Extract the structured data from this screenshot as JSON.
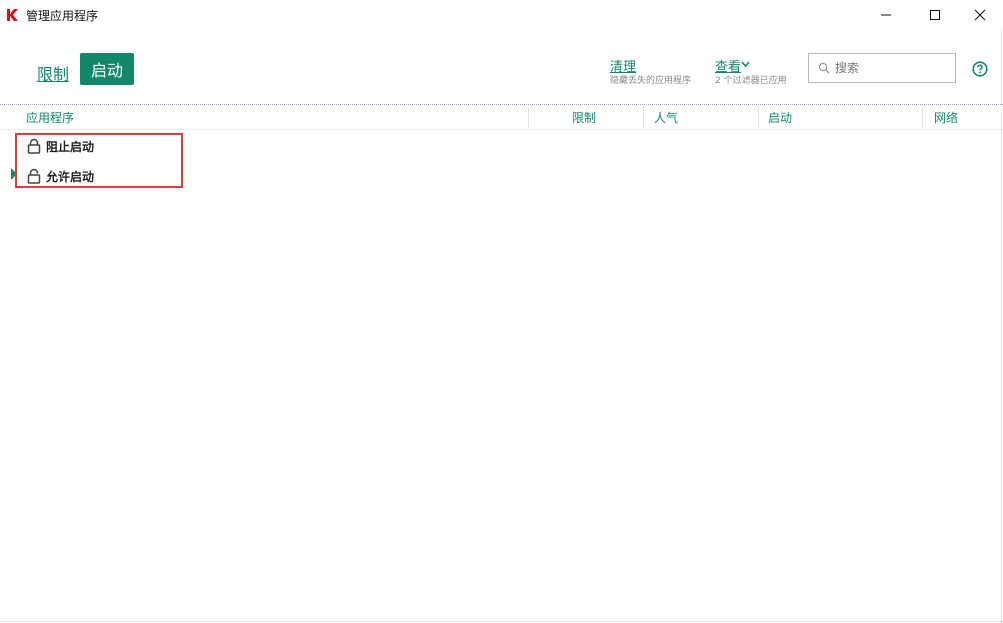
{
  "window": {
    "title": "管理应用程序",
    "icons": {
      "logo": "kaspersky-k-logo",
      "minimize": "minimize-icon",
      "maximize": "maximize-icon",
      "close": "close-icon"
    }
  },
  "tabs": {
    "restrict_label": "限制",
    "startup_label": "启动",
    "active": "启动"
  },
  "toolbar": {
    "clean_label": "清理",
    "clean_sub": "隐藏丢失的应用程序",
    "view_label": "查看",
    "view_sub": "2 个过滤器已应用",
    "search_placeholder": "搜索",
    "help_icon": "question-circle-icon"
  },
  "table": {
    "columns": [
      "应用程序",
      "限制",
      "人气",
      "启动",
      "网络"
    ],
    "groups": [
      {
        "label": "阻止启动",
        "icon": "locked-padlock-icon",
        "expanded": false
      },
      {
        "label": "允许启动",
        "icon": "unlocked-padlock-icon",
        "expanded": true
      }
    ]
  },
  "colors": {
    "accent": "#12876a",
    "highlight": "#e53a3a",
    "logo_red": "#d4141c"
  }
}
